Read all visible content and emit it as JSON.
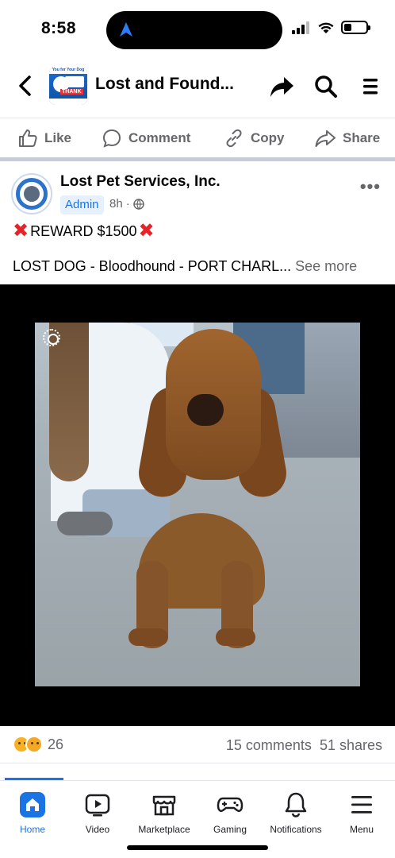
{
  "status_bar": {
    "time": "8:58",
    "battery_level": 0.35
  },
  "header": {
    "group_title": "Lost and Found...",
    "avatar_top_text": "You for Your Dog",
    "avatar_badge": "THANK"
  },
  "actions": [
    {
      "label": "Like",
      "icon": "thumbs-up-icon"
    },
    {
      "label": "Comment",
      "icon": "speech-bubble-icon"
    },
    {
      "label": "Copy",
      "icon": "link-icon"
    },
    {
      "label": "Share",
      "icon": "share-arrow-icon"
    }
  ],
  "post": {
    "author": "Lost Pet Services, Inc.",
    "badge": "Admin",
    "time": "8h",
    "reward": "REWARD $1500",
    "text": "LOST DOG - Bloodhound - PORT CHARL...",
    "see_more": "See more",
    "reaction_count": "26",
    "comments": "15 comments",
    "shares": "51 shares"
  },
  "tabs": [
    {
      "label": "Home",
      "active": true
    },
    {
      "label": "Video"
    },
    {
      "label": "Marketplace"
    },
    {
      "label": "Gaming"
    },
    {
      "label": "Notifications"
    },
    {
      "label": "Menu"
    }
  ],
  "colors": {
    "accent": "#1b74e4",
    "secondary_text": "#65676b",
    "reward_x": "#e3242b"
  }
}
